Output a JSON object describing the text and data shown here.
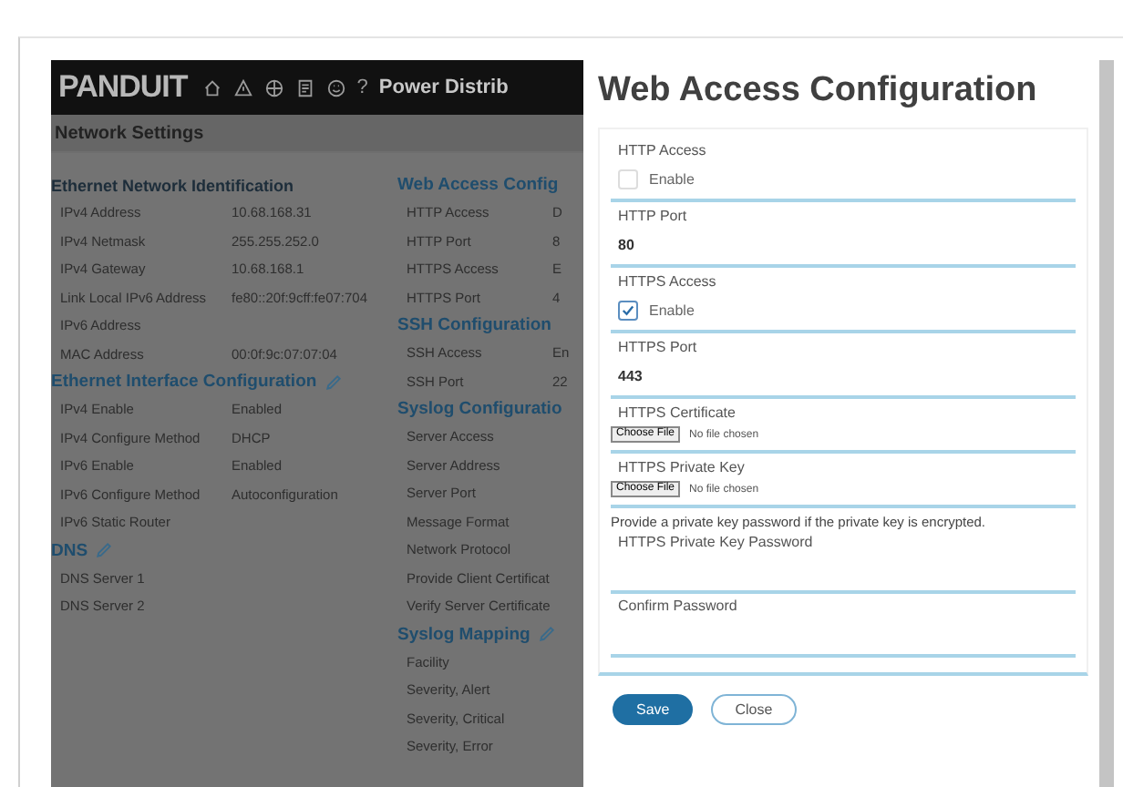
{
  "header": {
    "logo": "PANDUIT",
    "help": "?",
    "title": "Power Distrib"
  },
  "page_title": "Network Settings",
  "left_sections": [
    {
      "heading": "Ethernet Network Identification",
      "editable": false,
      "rows": [
        {
          "label": "IPv4 Address",
          "value": "10.68.168.31"
        },
        {
          "label": "IPv4 Netmask",
          "value": "255.255.252.0"
        },
        {
          "label": "IPv4 Gateway",
          "value": "10.68.168.1"
        },
        {
          "label": "Link Local IPv6 Address",
          "value": "fe80::20f:9cff:fe07:704"
        },
        {
          "label": "IPv6 Address",
          "value": ""
        },
        {
          "label": "MAC Address",
          "value": "00:0f:9c:07:07:04"
        }
      ]
    },
    {
      "heading": "Ethernet Interface Configuration",
      "editable": true,
      "rows": [
        {
          "label": "IPv4 Enable",
          "value": "Enabled"
        },
        {
          "label": "IPv4 Configure Method",
          "value": "DHCP"
        },
        {
          "label": "IPv6 Enable",
          "value": "Enabled"
        },
        {
          "label": "IPv6 Configure Method",
          "value": "Autoconfiguration"
        },
        {
          "label": "IPv6 Static Router",
          "value": ""
        }
      ]
    },
    {
      "heading": "DNS",
      "editable": true,
      "rows": [
        {
          "label": "DNS Server 1",
          "value": ""
        },
        {
          "label": "DNS Server 2",
          "value": ""
        }
      ]
    }
  ],
  "right_sections": [
    {
      "heading": "Web Access Config",
      "editable": false,
      "rows": [
        {
          "label": "HTTP Access",
          "value": "D"
        },
        {
          "label": "HTTP Port",
          "value": "8"
        },
        {
          "label": "HTTPS Access",
          "value": "E"
        },
        {
          "label": "HTTPS Port",
          "value": "4"
        }
      ]
    },
    {
      "heading": "SSH Configuration",
      "editable": false,
      "rows": [
        {
          "label": "SSH Access",
          "value": "En"
        },
        {
          "label": "SSH Port",
          "value": "22"
        }
      ]
    },
    {
      "heading": "Syslog Configuratio",
      "editable": false,
      "rows": [
        {
          "label": "Server Access",
          "value": ""
        },
        {
          "label": "Server Address",
          "value": ""
        },
        {
          "label": "Server Port",
          "value": ""
        },
        {
          "label": "Message Format",
          "value": ""
        },
        {
          "label": "Network Protocol",
          "value": ""
        },
        {
          "label": "Provide Client Certificat",
          "value": ""
        },
        {
          "label": "Verify Server Certificate",
          "value": ""
        }
      ]
    },
    {
      "heading": "Syslog Mapping",
      "editable": true,
      "rows": [
        {
          "label": "Facility",
          "value": ""
        },
        {
          "label": "Severity, Alert",
          "value": ""
        },
        {
          "label": "Severity, Critical",
          "value": ""
        },
        {
          "label": "Severity, Error",
          "value": ""
        }
      ]
    }
  ],
  "dialog": {
    "title": "Web Access Configuration",
    "fields": [
      {
        "kind": "checkbox",
        "label": "HTTP Access",
        "option": "Enable",
        "checked": false
      },
      {
        "kind": "text",
        "label": "HTTP Port",
        "value": "80"
      },
      {
        "kind": "checkbox",
        "label": "HTTPS Access",
        "option": "Enable",
        "checked": true
      },
      {
        "kind": "text",
        "label": "HTTPS Port",
        "value": "443"
      },
      {
        "kind": "file",
        "label": "HTTPS Certificate",
        "button": "Choose File",
        "status": "No file chosen"
      },
      {
        "kind": "file",
        "label": "HTTPS Private Key",
        "button": "Choose File",
        "status": "No file chosen"
      },
      {
        "kind": "note",
        "text": "Provide a private key password if the private key is encrypted."
      },
      {
        "kind": "password",
        "label": "HTTPS Private Key Password"
      },
      {
        "kind": "password",
        "label": "Confirm Password"
      }
    ],
    "buttons": [
      {
        "label": "Save",
        "primary": true
      },
      {
        "label": "Close",
        "primary": false
      }
    ]
  }
}
